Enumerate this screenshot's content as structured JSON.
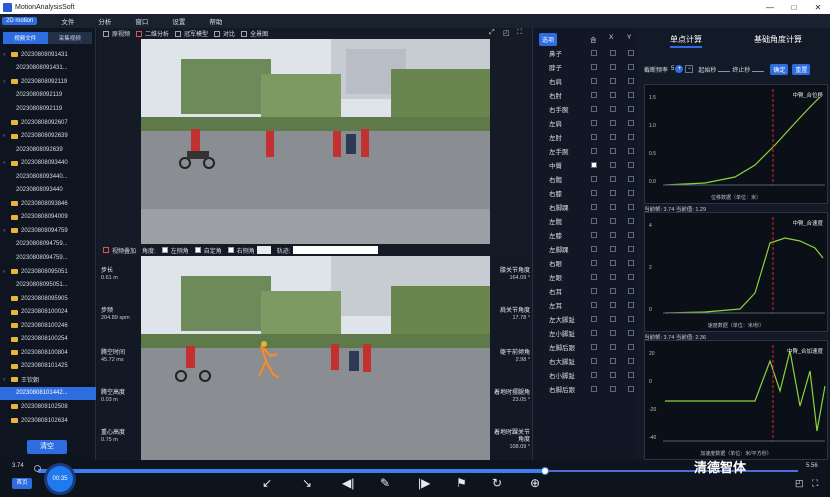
{
  "window": {
    "title": "MotionAnalysisSoft",
    "controls": [
      "—",
      "□",
      "✕"
    ]
  },
  "menu": {
    "mode": "2D motion",
    "items": [
      "文件",
      "分析",
      "窗口",
      "设置",
      "帮助"
    ]
  },
  "left": {
    "tabs": [
      "视频文件",
      "采集视频"
    ],
    "items": [
      {
        "label": "20230808091431",
        "folder": true,
        "arrow": "▿",
        "indent": 0
      },
      {
        "label": "20230808091431...",
        "folder": false,
        "indent": 1
      },
      {
        "label": "20230808092119",
        "folder": true,
        "arrow": "▿",
        "indent": 0
      },
      {
        "label": "20230808092119",
        "folder": false,
        "indent": 1
      },
      {
        "label": "20230808092119",
        "folder": false,
        "indent": 1
      },
      {
        "label": "20230808092607",
        "folder": true,
        "arrow": "",
        "indent": 0
      },
      {
        "label": "20230808092639",
        "folder": true,
        "arrow": "▿",
        "indent": 0
      },
      {
        "label": "20230808092639",
        "folder": false,
        "indent": 1
      },
      {
        "label": "20230808093440",
        "folder": true,
        "arrow": "▿",
        "indent": 0
      },
      {
        "label": "20230808093440...",
        "folder": false,
        "indent": 1
      },
      {
        "label": "20230808093440",
        "folder": false,
        "indent": 1
      },
      {
        "label": "20230808093846",
        "folder": true,
        "arrow": "",
        "indent": 0
      },
      {
        "label": "20230808094009",
        "folder": true,
        "arrow": "",
        "indent": 0
      },
      {
        "label": "20230808094759",
        "folder": true,
        "arrow": "▿",
        "indent": 0
      },
      {
        "label": "20230808094759...",
        "folder": false,
        "indent": 1
      },
      {
        "label": "20230808094759...",
        "folder": false,
        "indent": 1
      },
      {
        "label": "20230808095051",
        "folder": true,
        "arrow": "▿",
        "indent": 0
      },
      {
        "label": "20230808095051...",
        "folder": false,
        "indent": 1
      },
      {
        "label": "20230808095905",
        "folder": true,
        "arrow": "",
        "indent": 0
      },
      {
        "label": "20230808100024",
        "folder": true,
        "arrow": "",
        "indent": 0
      },
      {
        "label": "20230808100246",
        "folder": true,
        "arrow": "",
        "indent": 0
      },
      {
        "label": "20230808100254",
        "folder": true,
        "arrow": "",
        "indent": 0
      },
      {
        "label": "20230808100804",
        "folder": true,
        "arrow": "",
        "indent": 0
      },
      {
        "label": "20230808101425",
        "folder": true,
        "arrow": "",
        "indent": 0
      },
      {
        "label": "王钦朝",
        "folder": true,
        "arrow": "▿",
        "indent": 0
      },
      {
        "label": "20230808101442...",
        "folder": false,
        "indent": 1,
        "selected": true
      },
      {
        "label": "20230808102508",
        "folder": true,
        "arrow": "",
        "indent": 0
      },
      {
        "label": "20230808102634",
        "folder": true,
        "arrow": "",
        "indent": 0
      },
      {
        "label": "20230808102726",
        "folder": true,
        "arrow": "",
        "indent": 0
      }
    ],
    "clear_label": "清空"
  },
  "toolbar_top": [
    "原视频",
    "二维分析",
    "冠军模型",
    "对比",
    "全景图"
  ],
  "toolbar_bottom": {
    "video_overlay": "视频叠加",
    "angle_label": "角度:",
    "angle_opts": [
      "左侧角",
      "自定角",
      "右侧角"
    ],
    "track_label": "轨迹:"
  },
  "stats_left": [
    {
      "label": "步长",
      "value": "0.61 m"
    },
    {
      "label": "步频",
      "value": "204.89 spm"
    },
    {
      "label": "腾空时间",
      "value": "45.72 ms"
    },
    {
      "label": "腾空高度",
      "value": "0.03 m"
    },
    {
      "label": "重心高度",
      "value": "0.75 m"
    }
  ],
  "stats_right": [
    {
      "label": "膝关节角度",
      "value": "164.09 °"
    },
    {
      "label": "肩关节角度",
      "value": "17.78 °"
    },
    {
      "label": "躯干前倾角",
      "value": "2.98 °"
    },
    {
      "label": "着地时摆腿角",
      "value": "23.05 °"
    },
    {
      "label": "着地时踝关节角度",
      "value": "108.09 °"
    }
  ],
  "joints": {
    "header": "选项",
    "cols": [
      "合",
      "X",
      "Y"
    ],
    "names": [
      "鼻子",
      "脖子",
      "右肩",
      "右肘",
      "右手腕",
      "左肩",
      "左肘",
      "左手腕",
      "中臀",
      "右髋",
      "右膝",
      "右脚踝",
      "左髋",
      "左膝",
      "左脚踝",
      "右眼",
      "左眼",
      "右耳",
      "左耳",
      "左大脚趾",
      "左小脚趾",
      "左脚后跟",
      "右大脚趾",
      "右小脚趾",
      "右脚后跟"
    ],
    "checked_index": 8
  },
  "right": {
    "tabs": [
      "单点计算",
      "基础角度计算"
    ],
    "frame_label": "截断频率",
    "frame_value": "5",
    "start_label": "起始秒",
    "end_label": "终止秒",
    "confirm": "确定",
    "reset": "重置",
    "charts": [
      {
        "legend": "中臀_合位移",
        "current": "当前帧: 3.74 当前值: 1.29",
        "xlabel": "位移数据（单位：米）",
        "y_ticks": [
          "1.5",
          "1.0",
          "0.5",
          "0.0"
        ]
      },
      {
        "legend": "中臀_合速度",
        "current": "当前帧: 3.74 当前值: 2.36",
        "xlabel": "速度数据（单位：米/秒）",
        "y_ticks": [
          "4",
          "2",
          "0"
        ]
      },
      {
        "legend": "中臀_合加速度",
        "current": "当前帧: 3.74 当前值: 3.74",
        "xlabel": "加速度数据（单位：米/平方秒）",
        "y_ticks": [
          "20",
          "0",
          "-20",
          "-40"
        ]
      }
    ],
    "x_ticks": [
      "0",
      "1",
      "2",
      "3",
      "4",
      "5"
    ]
  },
  "timeline": {
    "start": "3.74",
    "end": "5.56",
    "current": "00:35",
    "home": "首页",
    "progress": 0.667
  },
  "watermark": "清德智体"
}
